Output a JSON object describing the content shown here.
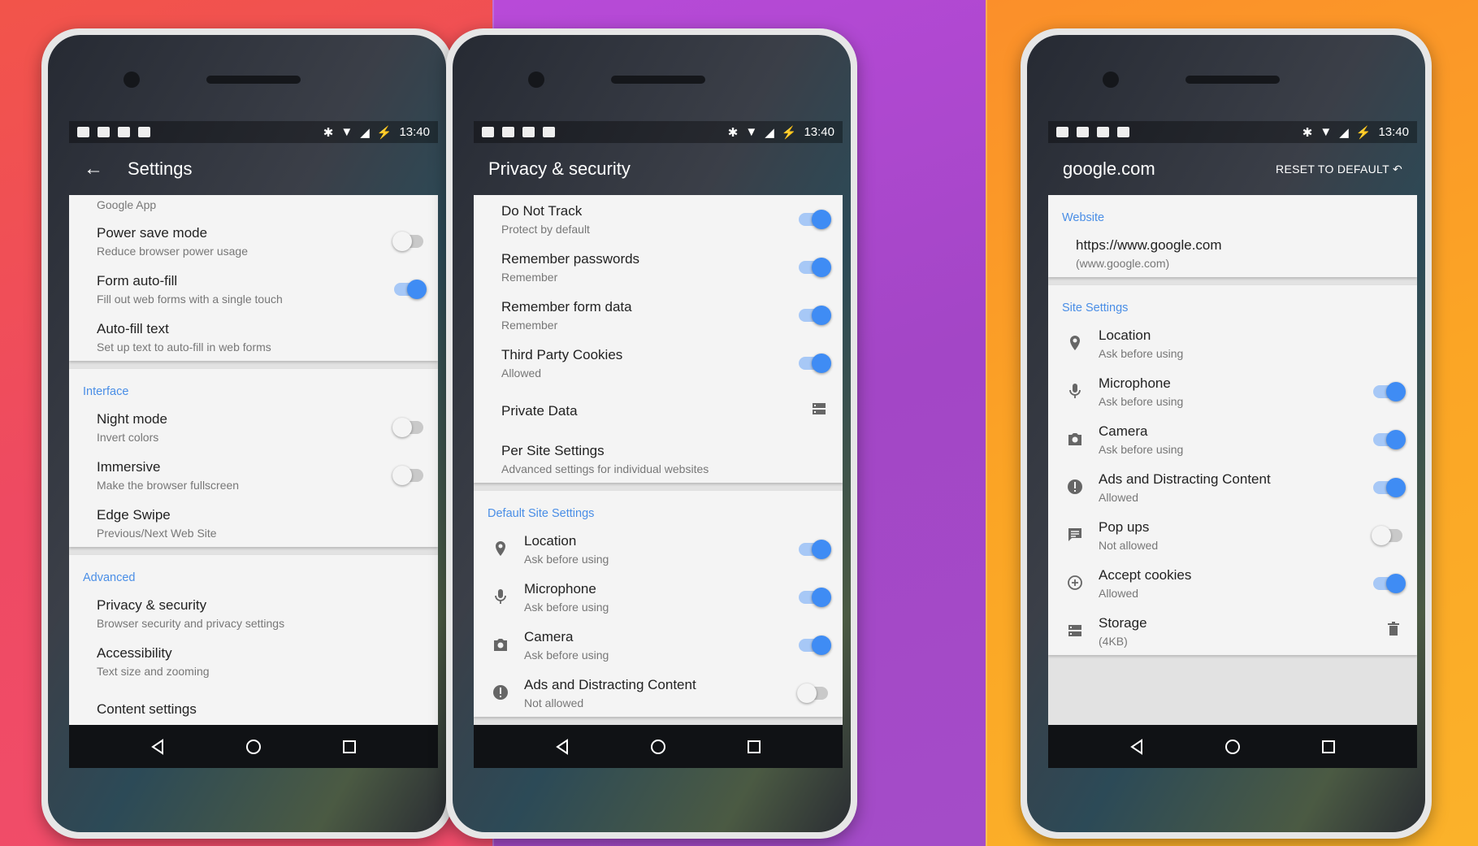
{
  "colors": {
    "accent": "#3f8cf4",
    "section": "#4a8ee6"
  },
  "phones": [
    {
      "status_time": "13:40",
      "title": "Settings",
      "back": true,
      "partial": "Google App",
      "sections": [
        {
          "items": [
            {
              "title": "Power save mode",
              "subtitle": "Reduce browser power usage",
              "control": "toggle",
              "on": false
            },
            {
              "title": "Form auto-fill",
              "subtitle": "Fill out web forms with a single touch",
              "control": "toggle",
              "on": true
            },
            {
              "title": "Auto-fill text",
              "subtitle": "Set up text to auto-fill in web forms"
            }
          ]
        },
        {
          "header": "Interface",
          "items": [
            {
              "title": "Night mode",
              "subtitle": "Invert colors",
              "control": "toggle",
              "on": false
            },
            {
              "title": "Immersive",
              "subtitle": "Make the browser fullscreen",
              "control": "toggle",
              "on": false
            },
            {
              "title": "Edge Swipe",
              "subtitle": "Previous/Next Web Site"
            }
          ]
        },
        {
          "header": "Advanced",
          "items": [
            {
              "title": "Privacy & security",
              "subtitle": "Browser security and privacy settings"
            },
            {
              "title": "Accessibility",
              "subtitle": "Text size and zooming"
            },
            {
              "title": "Content settings",
              "subtitle": ""
            }
          ]
        }
      ]
    },
    {
      "status_time": "13:40",
      "title": "Privacy & security",
      "back": false,
      "sections": [
        {
          "items": [
            {
              "title": "Do Not Track",
              "subtitle": "Protect by default",
              "control": "toggle",
              "on": true
            },
            {
              "title": "Remember passwords",
              "subtitle": "Remember",
              "control": "toggle",
              "on": true
            },
            {
              "title": "Remember form data",
              "subtitle": "Remember",
              "control": "toggle",
              "on": true
            },
            {
              "title": "Third Party Cookies",
              "subtitle": "Allowed",
              "control": "toggle",
              "on": true
            },
            {
              "title": "Private Data",
              "subtitle": "",
              "control": "icon",
              "control_icon": "storage-icon"
            },
            {
              "title": "Per Site Settings",
              "subtitle": "Advanced settings for individual websites"
            }
          ]
        },
        {
          "header": "Default Site Settings",
          "items": [
            {
              "icon": "location-icon",
              "title": "Location",
              "subtitle": "Ask before using",
              "control": "toggle",
              "on": true
            },
            {
              "icon": "microphone-icon",
              "title": "Microphone",
              "subtitle": "Ask before using",
              "control": "toggle",
              "on": true
            },
            {
              "icon": "camera-icon",
              "title": "Camera",
              "subtitle": "Ask before using",
              "control": "toggle",
              "on": true
            },
            {
              "icon": "alert-icon",
              "title": "Ads and Distracting Content",
              "subtitle": "Not allowed",
              "control": "toggle",
              "on": false
            }
          ]
        }
      ]
    },
    {
      "status_time": "13:40",
      "title": "google.com",
      "back": false,
      "action": "RESET TO DEFAULT",
      "sections": [
        {
          "header": "Website",
          "items": [
            {
              "title": "https://www.google.com",
              "subtitle": "(www.google.com)"
            }
          ]
        },
        {
          "header": "Site Settings",
          "items": [
            {
              "icon": "location-icon",
              "title": "Location",
              "subtitle": "Ask before using"
            },
            {
              "icon": "microphone-icon",
              "title": "Microphone",
              "subtitle": "Ask before using",
              "control": "toggle",
              "on": true
            },
            {
              "icon": "camera-icon",
              "title": "Camera",
              "subtitle": "Ask before using",
              "control": "toggle",
              "on": true
            },
            {
              "icon": "alert-icon",
              "title": "Ads and Distracting Content",
              "subtitle": "Allowed",
              "control": "toggle",
              "on": true
            },
            {
              "icon": "popup-icon",
              "title": "Pop ups",
              "subtitle": "Not allowed",
              "control": "toggle",
              "on": false
            },
            {
              "icon": "cookie-icon",
              "title": "Accept cookies",
              "subtitle": "Allowed",
              "control": "toggle",
              "on": true
            },
            {
              "icon": "storage-icon",
              "title": "Storage",
              "subtitle": "(4KB)",
              "control": "icon",
              "control_icon": "trash-icon"
            }
          ]
        }
      ]
    }
  ]
}
